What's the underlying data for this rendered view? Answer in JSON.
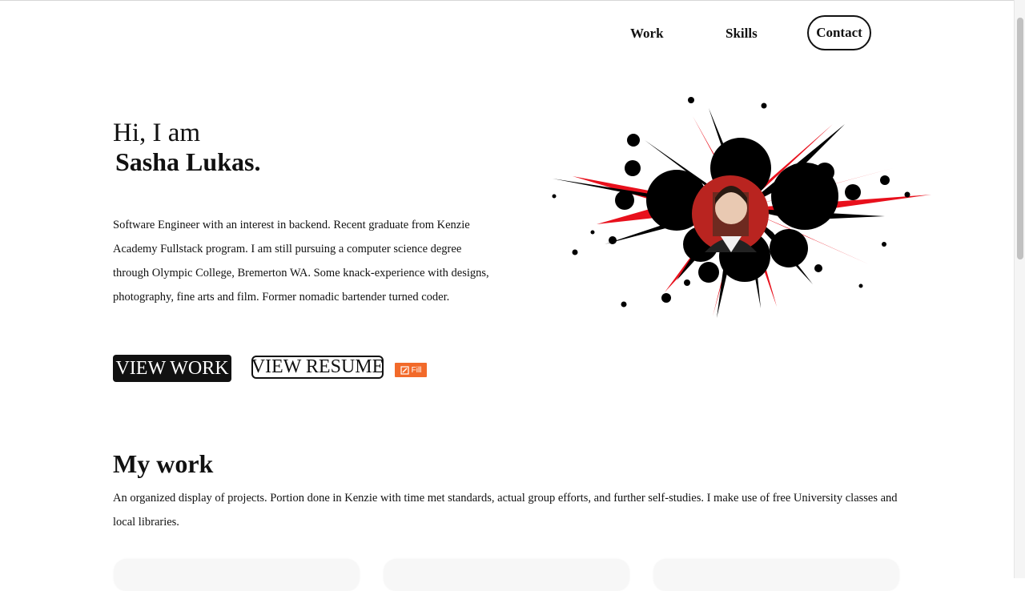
{
  "nav": {
    "items": [
      {
        "label": "Work"
      },
      {
        "label": "Skills"
      },
      {
        "label": "Contact"
      }
    ]
  },
  "hero": {
    "greeting": "Hi, I am",
    "name": "Sasha Lukas.",
    "bio": "Software Engineer with an interest in backend. Recent graduate from Kenzie Academy Fullstack program. I am still pursuing a computer science degree through Olympic College, Bremerton WA. Some knack-experience with designs, photography, fine arts and film. Former nomadic bartender turned coder.",
    "view_work_label": "VIEW WORK",
    "view_resume_label": "VIEW RESUME",
    "fill_badge_label": "Fill",
    "fill_badge_icon": "edit-icon"
  },
  "my_work": {
    "title": "My work",
    "description": "An organized display of projects. Portion done in Kenzie with time met standards, actual group efforts, and further self-studies. I make use of free University classes and local libraries."
  },
  "colors": {
    "text": "#111111",
    "background": "#ffffff",
    "badge": "#f26a2a",
    "splash_red": "#e8101c",
    "splash_black": "#000000"
  }
}
